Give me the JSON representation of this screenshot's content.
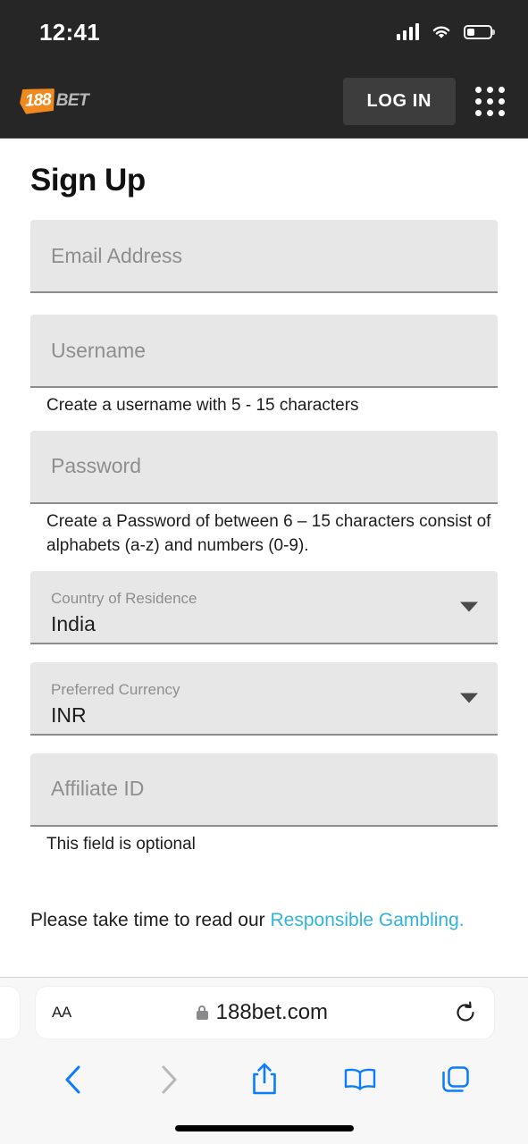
{
  "status_bar": {
    "time": "12:41",
    "signal_icon": "cellular-signal-icon",
    "wifi_icon": "wifi-icon",
    "battery_icon": "battery-icon",
    "battery_level_percent": 32
  },
  "site_header": {
    "logo_number": "188",
    "logo_word": "BET",
    "logo_accent_color": "#f08a1e",
    "login_label": "LOG IN",
    "menu_icon": "grid-menu-icon",
    "background_color": "#262626"
  },
  "page": {
    "title": "Sign Up",
    "fields": [
      {
        "name": "email",
        "type": "input",
        "placeholder": "Email Address",
        "value": "",
        "helper": ""
      },
      {
        "name": "username",
        "type": "input",
        "placeholder": "Username",
        "value": "",
        "helper": "Create a username with 5 - 15 characters"
      },
      {
        "name": "password",
        "type": "input",
        "placeholder": "Password",
        "value": "",
        "helper": "Create a Password of between 6 – 15 characters consist of alphabets (a-z) and numbers (0-9)."
      },
      {
        "name": "country",
        "type": "select",
        "label": "Country of Residence",
        "value": "India",
        "helper": ""
      },
      {
        "name": "currency",
        "type": "select",
        "label": "Preferred Currency",
        "value": "INR",
        "helper": ""
      },
      {
        "name": "affiliate",
        "type": "input",
        "placeholder": "Affiliate ID",
        "value": "",
        "helper": "This field is optional"
      }
    ],
    "notice_text": "Please take time to read our ",
    "notice_link": "Responsible Gambling.",
    "notice_link_color": "#32b3dd"
  },
  "browser": {
    "text_size_label": "AA",
    "lock_icon": "lock-icon",
    "url": "188bet.com",
    "reload_icon": "reload-icon",
    "toolbar": [
      {
        "name": "back",
        "icon": "chevron-left-icon",
        "enabled": true
      },
      {
        "name": "forward",
        "icon": "chevron-right-icon",
        "enabled": false
      },
      {
        "name": "share",
        "icon": "share-icon",
        "enabled": true
      },
      {
        "name": "bookmarks",
        "icon": "book-icon",
        "enabled": true
      },
      {
        "name": "tabs",
        "icon": "tabs-icon",
        "enabled": true
      }
    ],
    "accent_color": "#0a7cff"
  }
}
